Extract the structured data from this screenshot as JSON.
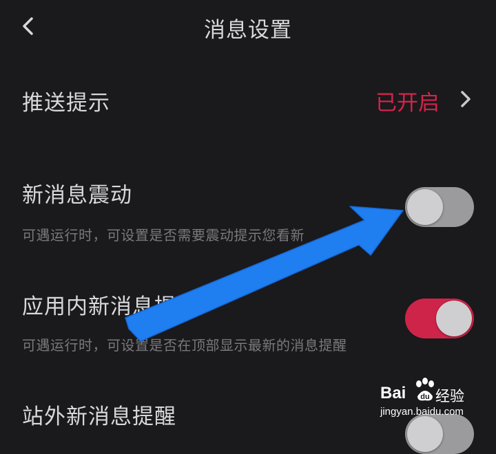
{
  "header": {
    "title": "消息设置"
  },
  "push": {
    "label": "推送提示",
    "status": "已开启"
  },
  "vibrate": {
    "label": "新消息震动",
    "desc": "可遇运行时，可设置是否需要震动提示您看新",
    "state": "off"
  },
  "in_app": {
    "label": "应用内新消息提醒",
    "desc": "可遇运行时，可设置是否在顶部显示最新的消息提醒",
    "state": "on"
  },
  "external": {
    "label": "站外新消息提醒"
  },
  "watermark": {
    "brand": "Bai",
    "brand_cn": "经验",
    "url": "jingyan.baidu.com"
  },
  "colors": {
    "background": "#1a191c",
    "accent": "#cf2449",
    "arrow": "#1f7ef0"
  }
}
